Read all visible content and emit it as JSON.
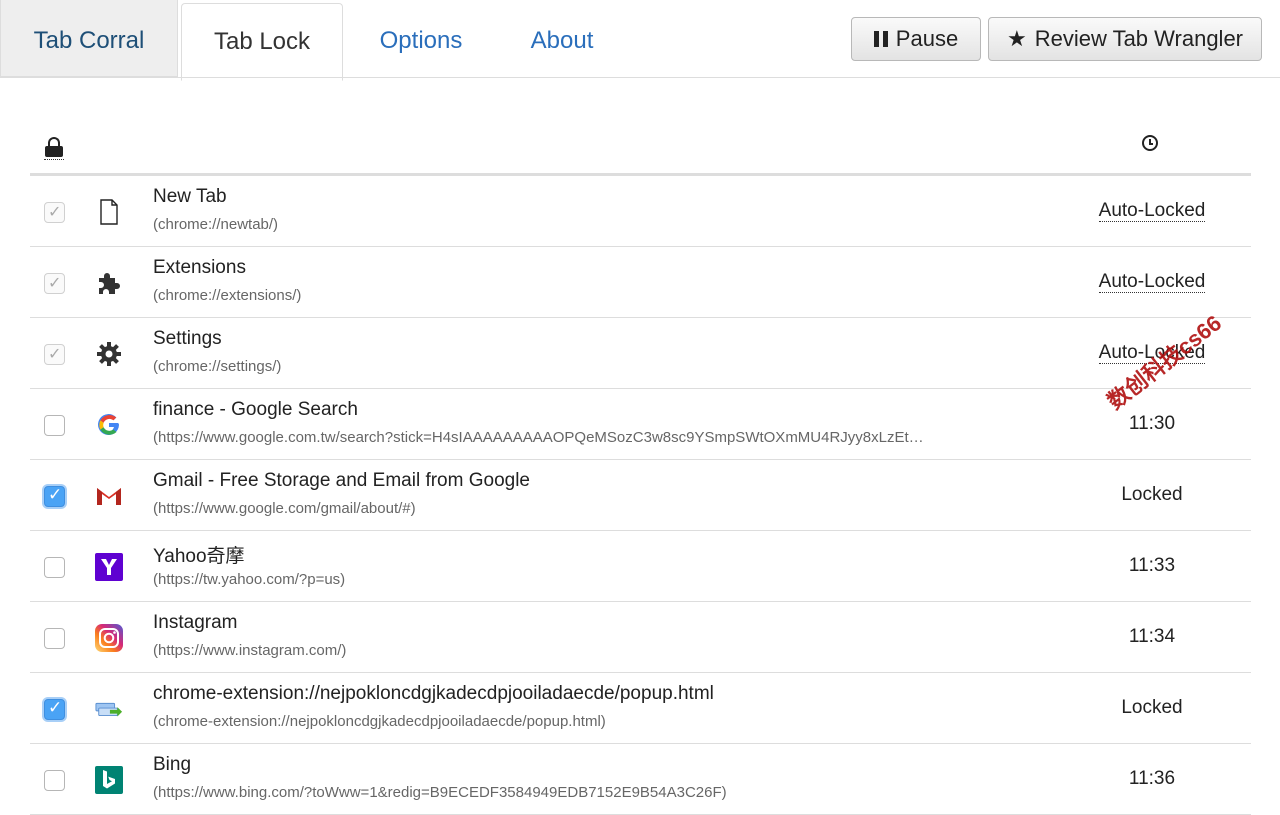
{
  "tabs": [
    {
      "label": "Tab Corral"
    },
    {
      "label": "Tab Lock"
    },
    {
      "label": "Options"
    },
    {
      "label": "About"
    }
  ],
  "buttons": {
    "pause": "Pause",
    "review": "Review Tab Wrangler"
  },
  "rows": [
    {
      "title": "New Tab",
      "url": "(chrome://newtab/)",
      "status": "Auto-Locked",
      "checkbox": "disabled",
      "icon": "document-icon"
    },
    {
      "title": "Extensions",
      "url": "(chrome://extensions/)",
      "status": "Auto-Locked",
      "checkbox": "disabled",
      "icon": "puzzle-icon"
    },
    {
      "title": "Settings",
      "url": "(chrome://settings/)",
      "status": "Auto-Locked",
      "checkbox": "disabled",
      "icon": "gear-icon"
    },
    {
      "title": "finance - Google Search",
      "url": "(https://www.google.com.tw/search?stick=H4sIAAAAAAAAAOPQeMSozC3w8sc9YSmpSWtOXmMU4RJyy8xLzEt…",
      "status": "11:30",
      "checkbox": "unchecked",
      "icon": "google-icon"
    },
    {
      "title": "Gmail - Free Storage and Email from Google",
      "url": "(https://www.google.com/gmail/about/#)",
      "status": "Locked",
      "checkbox": "checked",
      "icon": "gmail-icon"
    },
    {
      "title": "Yahoo奇摩",
      "url": "(https://tw.yahoo.com/?p=us)",
      "status": "11:33",
      "checkbox": "unchecked",
      "icon": "yahoo-icon"
    },
    {
      "title": "Instagram",
      "url": "(https://www.instagram.com/)",
      "status": "11:34",
      "checkbox": "unchecked",
      "icon": "instagram-icon"
    },
    {
      "title": "chrome-extension://nejpokloncdgjkadecdpjooiladaecde/popup.html",
      "url": "(chrome-extension://nejpokloncdgjkadecdpjooiladaecde/popup.html)",
      "status": "Locked",
      "checkbox": "checked",
      "icon": "extension-arrow-icon"
    },
    {
      "title": "Bing",
      "url": "(https://www.bing.com/?toWww=1&redig=B9ECEDF3584949EDB7152E9B54A3C26F)",
      "status": "11:36",
      "checkbox": "unchecked",
      "icon": "bing-icon"
    }
  ],
  "watermark": "数创科技cs66"
}
